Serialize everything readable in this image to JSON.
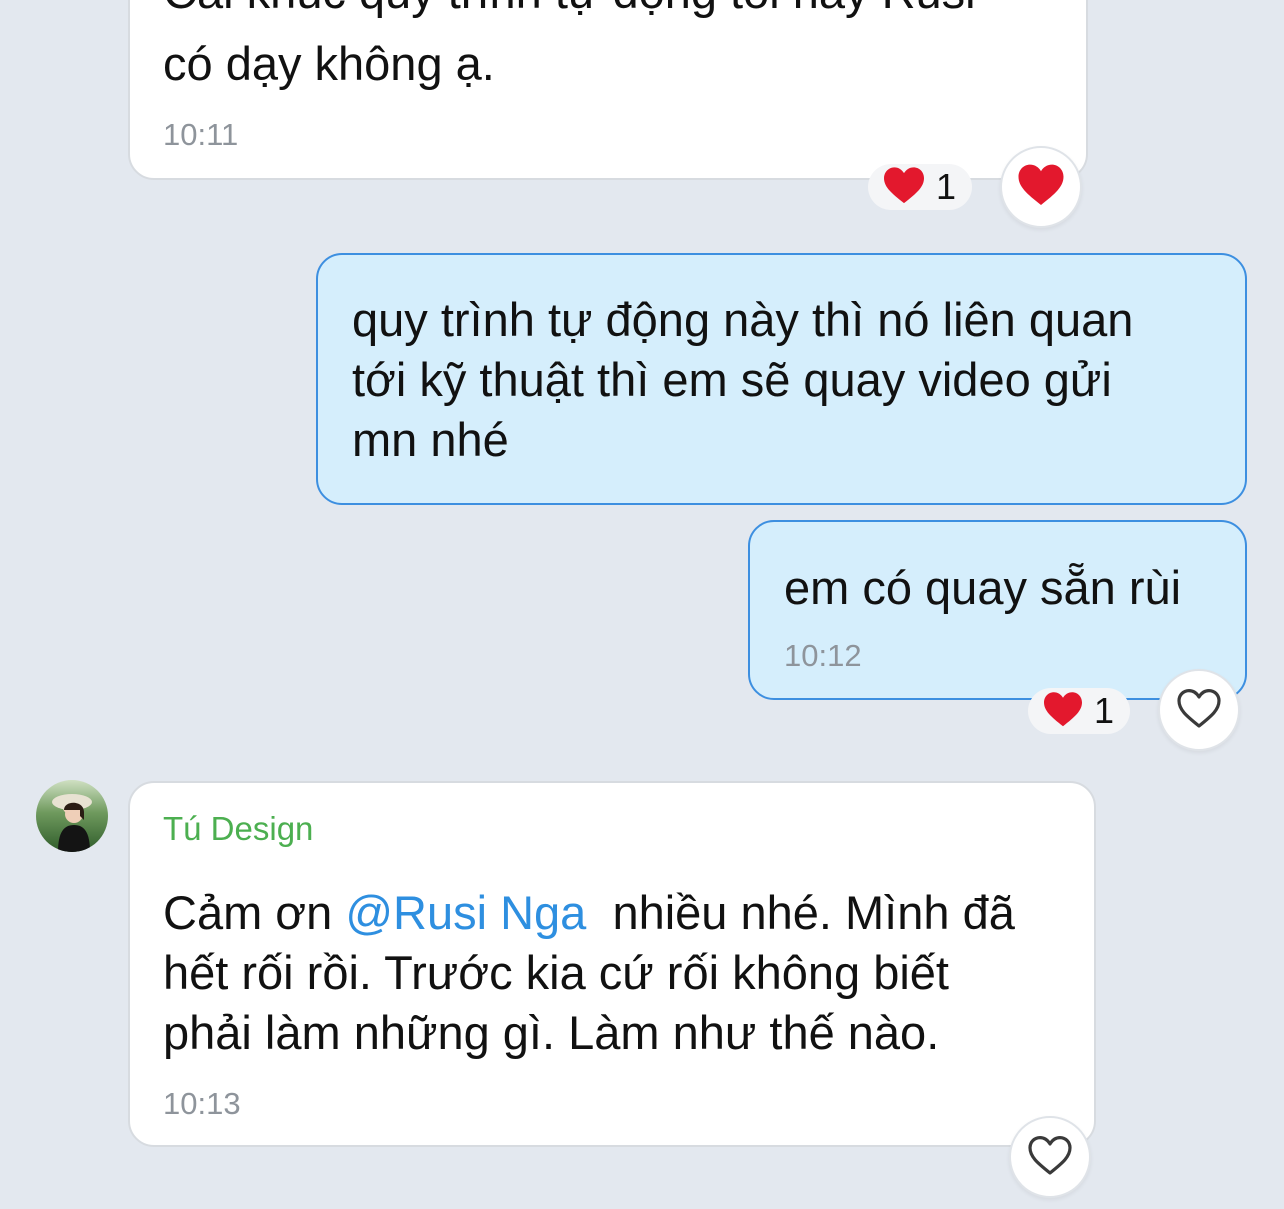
{
  "colors": {
    "background": "#e3e8ef",
    "incoming_bubble": "#ffffff",
    "outgoing_bubble": "#d5eefc",
    "outgoing_border": "#3d8fe0",
    "sender_name": "#4caf50",
    "mention": "#2e8fe0",
    "timestamp": "#8e949b",
    "heart": "#e3182d"
  },
  "messages": [
    {
      "direction": "incoming",
      "lines": [
        "Cái khúc quy trình tự động tối nay Rusi",
        "có dạy không ạ."
      ],
      "time": "10:11",
      "reaction": {
        "icon": "heart-filled-icon",
        "count": "1"
      },
      "reacted_by_me": true
    },
    {
      "direction": "outgoing",
      "lines": [
        "quy trình tự động này thì nó liên quan",
        "tới kỹ thuật thì em sẽ quay video gửi",
        "mn nhé"
      ]
    },
    {
      "direction": "outgoing",
      "lines": [
        "em có quay sẵn rùi"
      ],
      "time": "10:12",
      "reaction": {
        "icon": "heart-filled-icon",
        "count": "1"
      },
      "reacted_by_me": false
    },
    {
      "direction": "incoming",
      "sender": "Tú Design",
      "line1_before": "Cảm ơn ",
      "mention": "@Rusi Nga",
      "line1_after": "  nhiều nhé. Mình đã",
      "lines": [
        "hết rối rồi. Trước kia cứ rối không biết",
        "phải làm những gì. Làm như thế nào."
      ],
      "time": "10:13",
      "reacted_by_me": false
    }
  ]
}
